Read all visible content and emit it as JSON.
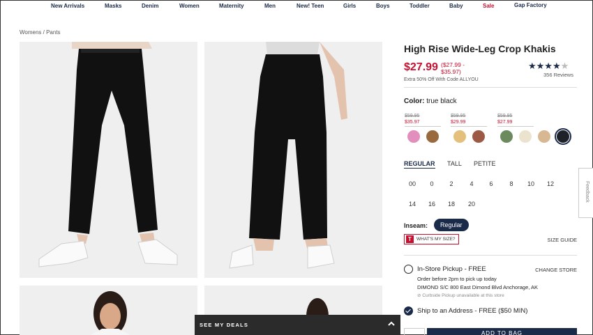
{
  "nav": [
    "New Arrivals",
    "Masks",
    "Denim",
    "Women",
    "Maternity",
    "Men",
    "New! Teen",
    "Girls",
    "Boys",
    "Toddler",
    "Baby",
    "Sale",
    "Gap Factory"
  ],
  "breadcrumb": "Womens / Pants",
  "product": {
    "title": "High Rise Wide-Leg Crop Khakis",
    "price": "$27.99",
    "range": "($27.99 - $35.97)",
    "promo": "Extra 50% Off With Code ALLYOU",
    "stars": "★★★★",
    "half_star": "★",
    "reviews": "356 Reviews"
  },
  "color": {
    "label": "Color:",
    "value": "true black",
    "groups": [
      {
        "was": "$59.95",
        "now": "$35.97"
      },
      {
        "was": "$59.95",
        "now": "$29.99"
      },
      {
        "was": "$59.95",
        "now": "$27.99"
      }
    ],
    "swatches": [
      "#e28fbd",
      "#9a6a3f",
      "#e3c07c",
      "#9c5a44",
      "#6b8a5e",
      "#ece3cf",
      "#d8b893",
      "#1e2228"
    ],
    "selected_index": 7
  },
  "fits": [
    "REGULAR",
    "TALL",
    "PETITE"
  ],
  "sizes": [
    "00",
    "0",
    "2",
    "4",
    "6",
    "8",
    "10",
    "12",
    "14",
    "16",
    "18",
    "20"
  ],
  "inseam": {
    "label": "Inseam:",
    "value": "Regular"
  },
  "whats_my_size": "WHAT'S MY SIZE?",
  "size_guide": "SIZE GUIDE",
  "pickup": {
    "label": "In-Store Pickup - FREE",
    "change": "CHANGE STORE",
    "order_note": "Order before 2pm to pick up today",
    "store": "DIMOND S/C 800 East Dimond Blvd Anchorage, AK",
    "curbside": "⊘ Curbside Pickup unavailable at this store"
  },
  "ship": {
    "label": "Ship to an Address - FREE ($50 MIN)"
  },
  "add_to_bag": "ADD TO BAG",
  "deals": "SEE MY DEALS",
  "feedback": "Feedback",
  "colors": {
    "navy": "#1a2b49",
    "sale_red": "#c8102e"
  }
}
